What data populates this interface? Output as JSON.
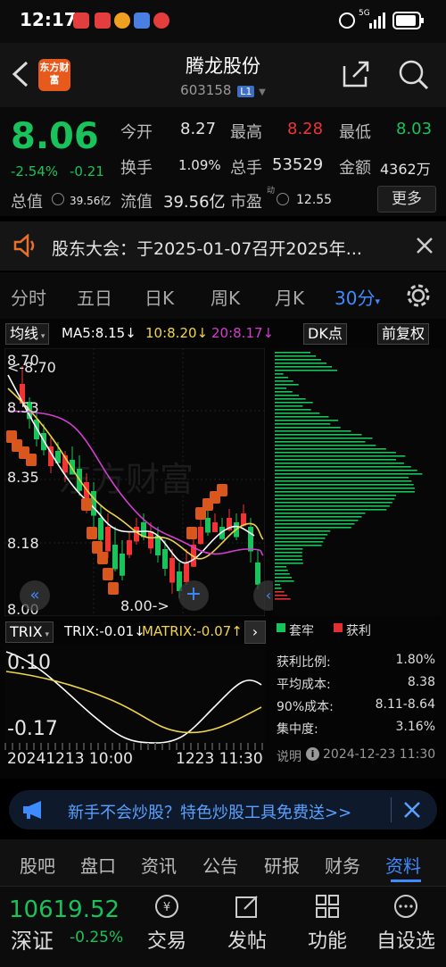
{
  "status_bar": {
    "time": "12:17",
    "network": "5G",
    "signal": "||||"
  },
  "header": {
    "logo_text": "东方财富",
    "title": "腾龙股份",
    "code": "603158",
    "level_badge": "L1"
  },
  "quote": {
    "price": "8.06",
    "change_pct": "-2.54%",
    "change_amt": "-0.21",
    "open_label": "今开",
    "open": "8.27",
    "high_label": "最高",
    "high": "8.28",
    "low_label": "最低",
    "low": "8.03",
    "turnover_label": "换手",
    "turnover": "1.09%",
    "volume_label": "总手",
    "volume": "53529",
    "amount_label": "金额",
    "amount": "4362万",
    "total_mv_label": "总值",
    "total_mv": "39.56亿",
    "float_mv_label": "流值",
    "float_mv": "39.56亿",
    "pe_label": "市盈",
    "pe_sup": "动",
    "pe": "12.55",
    "more_label": "更多"
  },
  "notice": {
    "text": "股东大会：于2025-01-07召开2025年..."
  },
  "period_tabs": [
    "分时",
    "五日",
    "日K",
    "周K",
    "月K",
    "30分"
  ],
  "chart_toolbar": {
    "indicator": "均线",
    "ma5": "MA5:8.15↓",
    "ma10": "10:8.20↓",
    "ma20": "20:8.17↓",
    "dk": "DK点",
    "adjust": "前复权"
  },
  "kline": {
    "y_labels": [
      "8.70",
      "8.53",
      "8.35",
      "8.18",
      "8.00"
    ],
    "high_marker": "<-8.70",
    "low_marker": "8.00->",
    "watermark": "东方财富"
  },
  "trix_toolbar": {
    "name": "TRIX",
    "trix": "TRIX:-0.01↓",
    "matrix": "MATRIX:-0.07↑"
  },
  "trix": {
    "y_top": "0.10",
    "y_bottom": "-0.17",
    "date_left": "20241213 10:00",
    "date_right": "1223 11:30"
  },
  "chip": {
    "legend_trapped": "套牢",
    "legend_profit": "获利",
    "rows": [
      {
        "label": "获利比例:",
        "value": "1.80%"
      },
      {
        "label": "平均成本:",
        "value": "8.38"
      },
      {
        "label": "90%成本:",
        "value": "8.11-8.64"
      },
      {
        "label": "集中度:",
        "value": "3.16%"
      }
    ],
    "note_label": "说明",
    "note_time": "2024-12-23 11:30"
  },
  "banner": {
    "text": "新手不会炒股？特色炒股工具免费送>>"
  },
  "bottom_tabs": [
    "股吧",
    "盘口",
    "资讯",
    "公告",
    "研报",
    "财务",
    "资料"
  ],
  "index": {
    "value": "10619.52",
    "name": "深证",
    "change": "-0.25%"
  },
  "bottom_actions": [
    "交易",
    "发帖",
    "功能",
    "自设选"
  ],
  "colors": {
    "up": "#f03434",
    "down": "#19c35b",
    "accent": "#3d8bff",
    "brand": "#e85a1b"
  }
}
